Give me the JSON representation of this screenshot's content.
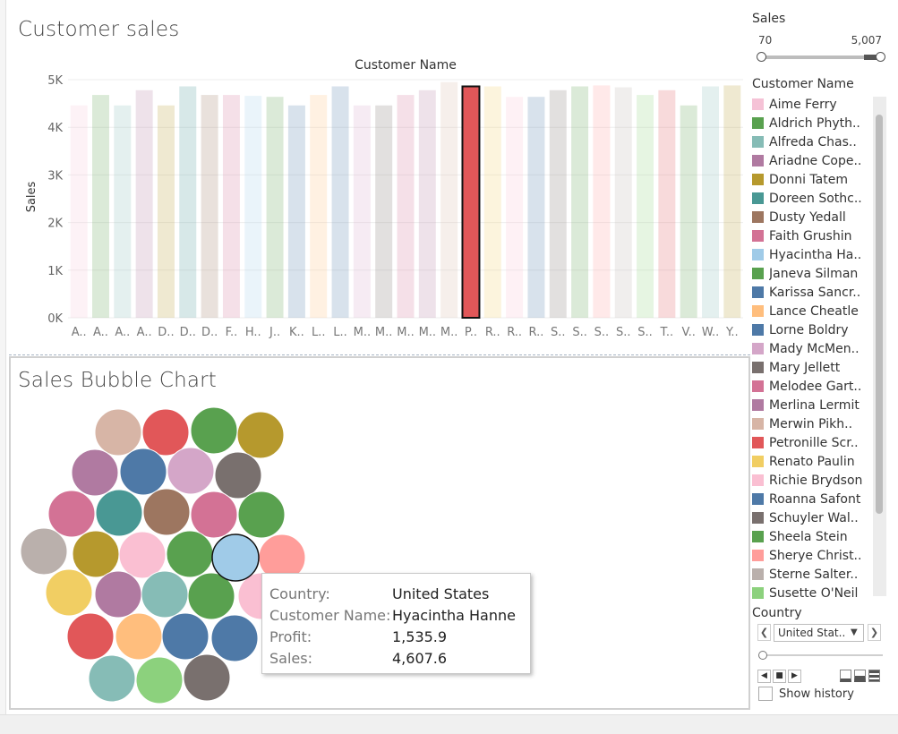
{
  "top_chart": {
    "title": "Customer sales",
    "column_header": "Customer Name",
    "ylabel": "Sales"
  },
  "chart_data": {
    "type": "bar",
    "title": "Customer sales",
    "xlabel": "Customer Name",
    "ylabel": "Sales",
    "ylim": [
      0,
      5000
    ],
    "yticks": [
      "0K",
      "1K",
      "2K",
      "3K",
      "4K",
      "5K"
    ],
    "categories": [
      "A..",
      "A..",
      "A..",
      "A..",
      "D..",
      "D..",
      "D..",
      "F..",
      "H..",
      "J..",
      "K..",
      "L..",
      "L..",
      "M..",
      "M..",
      "M..",
      "M..",
      "M..",
      "P..",
      "R..",
      "R..",
      "R..",
      "S..",
      "S..",
      "S..",
      "S..",
      "S..",
      "T..",
      "V..",
      "W..",
      "Y.."
    ],
    "values": [
      4460,
      4680,
      4460,
      4780,
      4460,
      4860,
      4680,
      4680,
      4660,
      4640,
      4460,
      4680,
      4860,
      4460,
      4460,
      4680,
      4780,
      4950,
      4860,
      4860,
      4640,
      4640,
      4780,
      4860,
      4880,
      4840,
      4680,
      4780,
      4460,
      4860,
      4880
    ],
    "colors": [
      "#f5c2d6",
      "#59a14f",
      "#86bcb6",
      "#b07aa1",
      "#b6992d",
      "#499894",
      "#9d7660",
      "#d37295",
      "#a0cbe8",
      "#59a14f",
      "#4e79a7",
      "#ffbe7d",
      "#4e79a7",
      "#d4a6c8",
      "#79706e",
      "#d37295",
      "#b07aa1",
      "#d7b5a6",
      "#e15759",
      "#f1ce63",
      "#fabfd2",
      "#4e79a7",
      "#79706e",
      "#59a14f",
      "#ff9d9a",
      "#bab0ac",
      "#8cd17d",
      "#e15759",
      "#59a14f",
      "#86bcb6",
      "#b6992d"
    ],
    "highlight_index": 18
  },
  "bubble_chart": {
    "title": "Sales Bubble Chart",
    "bubbles": [
      {
        "color": "#d7b5a6",
        "label": "Merwin Pikh.."
      },
      {
        "color": "#e15759",
        "label": "Petronille Scr.."
      },
      {
        "color": "#59a14f",
        "label": "Sheela Stein"
      },
      {
        "color": "#b6992d",
        "label": "Donni Tatem"
      },
      {
        "color": "#b07aa1",
        "label": "Merlina Lermit"
      },
      {
        "color": "#4e79a7",
        "label": "Karissa Sancr.."
      },
      {
        "color": "#d4a6c8",
        "label": "Mady McMen.."
      },
      {
        "color": "#79706e",
        "label": "Mary Jellett"
      },
      {
        "color": "#d37295",
        "label": "Melodee Gart.."
      },
      {
        "color": "#499894",
        "label": "Doreen Sothc.."
      },
      {
        "color": "#9d7660",
        "label": "Dusty Yedall"
      },
      {
        "color": "#d37295",
        "label": "Faith Grushin"
      },
      {
        "color": "#59a14f",
        "label": "Janeva Silman"
      },
      {
        "color": "#bab0ac",
        "label": "Sterne Salter.."
      },
      {
        "color": "#b6992d",
        "label": "Donni Tatem"
      },
      {
        "color": "#fabfd2",
        "label": "Richie Brydson"
      },
      {
        "color": "#59a14f",
        "label": "Aldrich Phyth.."
      },
      {
        "color": "#a0cbe8",
        "label": "Hyacintha Ha.."
      },
      {
        "color": "#ff9d9a",
        "label": "Sherye Christ.."
      },
      {
        "color": "#f1ce63",
        "label": "Renato Paulin"
      },
      {
        "color": "#b07aa1",
        "label": "Ariadne Cope.."
      },
      {
        "color": "#86bcb6",
        "label": "Alfreda Chas.."
      },
      {
        "color": "#59a14f",
        "label": "Sheela Stein"
      },
      {
        "color": "#fabfd2",
        "label": "Aime Ferry"
      },
      {
        "color": "#e15759",
        "label": "Petronille Scr.."
      },
      {
        "color": "#ffbe7d",
        "label": "Lance Cheatle"
      },
      {
        "color": "#4e79a7",
        "label": "Lorne Boldry"
      },
      {
        "color": "#4e79a7",
        "label": "Roanna Safont"
      },
      {
        "color": "#86bcb6",
        "label": "Alfreda Chas.."
      },
      {
        "color": "#8cd17d",
        "label": "Susette O'Neil"
      },
      {
        "color": "#79706e",
        "label": "Schuyler Wal.."
      }
    ],
    "selected_index": 17
  },
  "tooltip": {
    "rows": [
      {
        "key": "Country:",
        "value": "United States"
      },
      {
        "key": "Customer Name:",
        "value": "Hyacintha Hanne"
      },
      {
        "key": "Profit:",
        "value": "1,535.9"
      },
      {
        "key": "Sales:",
        "value": "4,607.6"
      }
    ]
  },
  "filters": {
    "sales": {
      "title": "Sales",
      "min_label": "70",
      "max_label": "5,007"
    },
    "customer_legend": {
      "title": "Customer Name",
      "items": [
        {
          "label": "Aime Ferry",
          "color": "#f5c2d6"
        },
        {
          "label": "Aldrich Phyth..",
          "color": "#59a14f"
        },
        {
          "label": "Alfreda Chas..",
          "color": "#86bcb6"
        },
        {
          "label": "Ariadne Cope..",
          "color": "#b07aa1"
        },
        {
          "label": "Donni Tatem",
          "color": "#b6992d"
        },
        {
          "label": "Doreen Sothc..",
          "color": "#499894"
        },
        {
          "label": "Dusty Yedall",
          "color": "#9d7660"
        },
        {
          "label": "Faith Grushin",
          "color": "#d37295"
        },
        {
          "label": "Hyacintha Ha..",
          "color": "#a0cbe8"
        },
        {
          "label": "Janeva Silman",
          "color": "#59a14f"
        },
        {
          "label": "Karissa Sancr..",
          "color": "#4e79a7"
        },
        {
          "label": "Lance Cheatle",
          "color": "#ffbe7d"
        },
        {
          "label": "Lorne Boldry",
          "color": "#4e79a7"
        },
        {
          "label": "Mady McMen..",
          "color": "#d4a6c8"
        },
        {
          "label": "Mary Jellett",
          "color": "#79706e"
        },
        {
          "label": "Melodee Gart..",
          "color": "#d37295"
        },
        {
          "label": "Merlina Lermit",
          "color": "#b07aa1"
        },
        {
          "label": "Merwin Pikh..",
          "color": "#d7b5a6"
        },
        {
          "label": "Petronille Scr..",
          "color": "#e15759"
        },
        {
          "label": "Renato Paulin",
          "color": "#f1ce63"
        },
        {
          "label": "Richie Brydson",
          "color": "#fabfd2"
        },
        {
          "label": "Roanna Safont",
          "color": "#4e79a7"
        },
        {
          "label": "Schuyler Wal..",
          "color": "#79706e"
        },
        {
          "label": "Sheela Stein",
          "color": "#59a14f"
        },
        {
          "label": "Sherye Christ..",
          "color": "#ff9d9a"
        },
        {
          "label": "Sterne Salter..",
          "color": "#bab0ac"
        },
        {
          "label": "Susette O'Neil",
          "color": "#8cd17d"
        }
      ]
    },
    "country": {
      "title": "Country",
      "selected": "United Stat..",
      "show_history_label": "Show history",
      "prev_glyph": "❮",
      "next_glyph": "❯",
      "caret_glyph": "▼",
      "play_back_glyph": "◀",
      "stop_glyph": "■",
      "play_glyph": "▶"
    }
  }
}
